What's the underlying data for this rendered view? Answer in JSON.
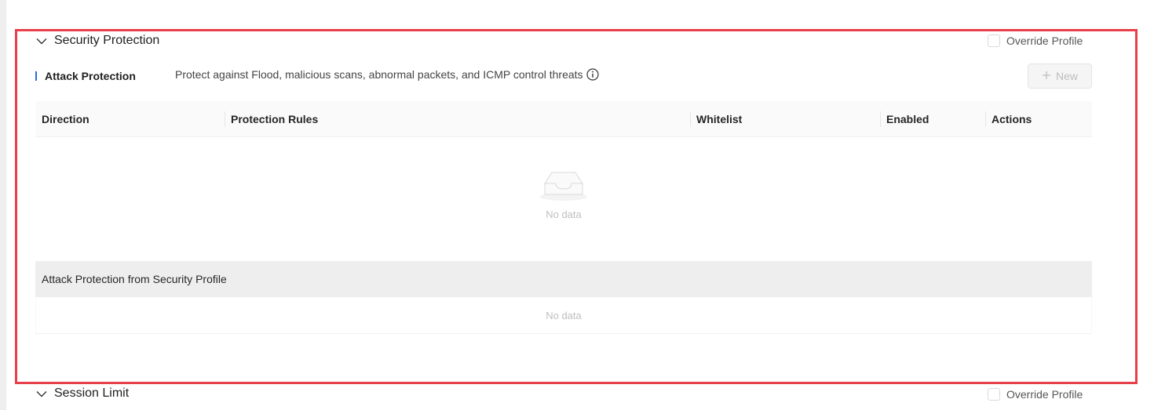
{
  "security_section": {
    "title": "Security Protection",
    "override_label": "Override Profile"
  },
  "attack_protection": {
    "title": "Attack Protection",
    "description": "Protect against Flood, malicious scans, abnormal packets, and ICMP control threats",
    "new_button": "New",
    "columns": [
      "Direction",
      "Protection Rules",
      "Whitelist",
      "Enabled",
      "Actions"
    ],
    "empty_text": "No data"
  },
  "profile_table": {
    "title": "Attack Protection from Security Profile",
    "empty_text": "No data"
  },
  "session_section": {
    "title": "Session Limit",
    "override_label": "Override Profile"
  },
  "icons": {
    "collapse": "chevron-down-icon",
    "info": "info-icon",
    "add": "plus-icon",
    "empty": "empty-inbox-icon"
  },
  "colors": {
    "highlight": "#e8404a",
    "accent": "#2f6bd8"
  }
}
